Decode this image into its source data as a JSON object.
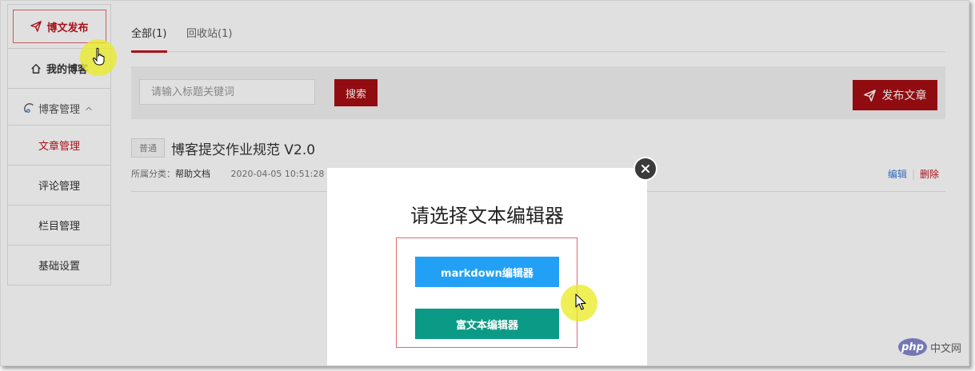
{
  "sidebar": {
    "publish_label": "博文发布",
    "my_blog_label": "我的博客",
    "manage_group_label": "博客管理",
    "items": [
      {
        "label": "文章管理",
        "active": true
      },
      {
        "label": "评论管理",
        "active": false
      },
      {
        "label": "栏目管理",
        "active": false
      },
      {
        "label": "基础设置",
        "active": false
      }
    ]
  },
  "tabs": [
    {
      "label": "全部(1)",
      "active": true
    },
    {
      "label": "回收站(1)",
      "active": false
    }
  ],
  "search": {
    "placeholder": "请输入标题关键词",
    "button_label": "搜索"
  },
  "publish_button_label": "发布文章",
  "article": {
    "badge": "普通",
    "title": "博客提交作业规范 V2.0",
    "category_label": "所属分类：",
    "category": "帮助文档",
    "date": "2020-04-05 10:51:28",
    "edit_label": "编辑",
    "delete_label": "删除"
  },
  "modal": {
    "title": "请选择文本编辑器",
    "markdown_label": "markdown编辑器",
    "richtext_label": "富文本编辑器"
  },
  "watermark": {
    "logo": "php",
    "text": "中文网"
  },
  "colors": {
    "brand_red": "#a50e14",
    "markdown_blue": "#22a0f5",
    "richtext_teal": "#0b9a85"
  }
}
